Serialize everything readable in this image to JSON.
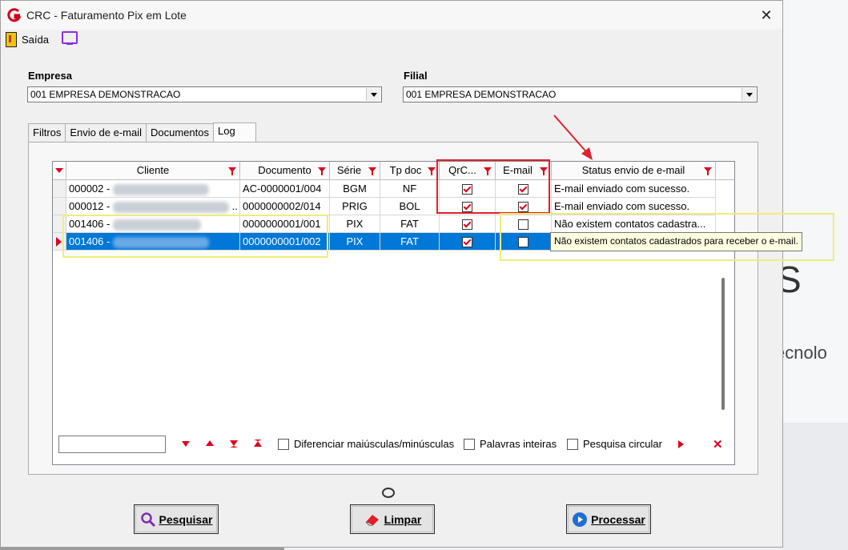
{
  "window": {
    "title": "CRC - Faturamento Pix em Lote",
    "close_glyph": "✕"
  },
  "menu": {
    "exit_label": "Saída",
    "exit_icon": "exit-door-icon",
    "screen_icon": "monitor-icon"
  },
  "empresa": {
    "label": "Empresa",
    "value": "001 EMPRESA DEMONSTRACAO"
  },
  "filial": {
    "label": "Filial",
    "value": "001 EMPRESA DEMONSTRACAO"
  },
  "tabs": [
    {
      "label": "Filtros"
    },
    {
      "label": "Envio de e-mail"
    },
    {
      "label": "Documentos"
    },
    {
      "label": "Log",
      "active": true
    }
  ],
  "grid": {
    "columns": [
      "Cliente",
      "Documento",
      "Série",
      "Tp doc",
      "QrC...",
      "E-mail",
      "Status envio de e-mail"
    ],
    "rows": [
      {
        "cliente": "000002 -",
        "documento": "AC-0000001/004",
        "serie": "BGM",
        "tpdoc": "NF",
        "qrc": true,
        "email": true,
        "status": "E-mail enviado com sucesso."
      },
      {
        "cliente": "000012 -",
        "cliente_suffix": "..",
        "documento": "0000000002/014",
        "serie": "PRIG",
        "tpdoc": "BOL",
        "qrc": true,
        "email": true,
        "status": "E-mail enviado com sucesso."
      },
      {
        "cliente": "001406 -",
        "documento": "0000000001/001",
        "serie": "PIX",
        "tpdoc": "FAT",
        "qrc": true,
        "email": false,
        "status": "Não existem contatos cadastra..."
      },
      {
        "cliente": "001406 -",
        "documento": "0000000001/002",
        "serie": "PIX",
        "tpdoc": "FAT",
        "qrc": true,
        "email": false,
        "status": "",
        "selected": true
      }
    ],
    "tooltip": "Não existem contatos cadastrados para receber o e-mail."
  },
  "search": {
    "value": "",
    "options": [
      "Diferenciar maiúsculas/minúsculas",
      "Palavras inteiras",
      "Pesquisa circular"
    ]
  },
  "buttons": {
    "search": "Pesquisar",
    "clear": "Limpar",
    "process": "Processar"
  },
  "background": {
    "letter": "S",
    "word": "ecnolo"
  },
  "colors": {
    "accent_red": "#e0001a",
    "selection_blue": "#0078d7",
    "annotation_yellow": "#f0ec7a",
    "annotation_red": "#e0202a"
  }
}
